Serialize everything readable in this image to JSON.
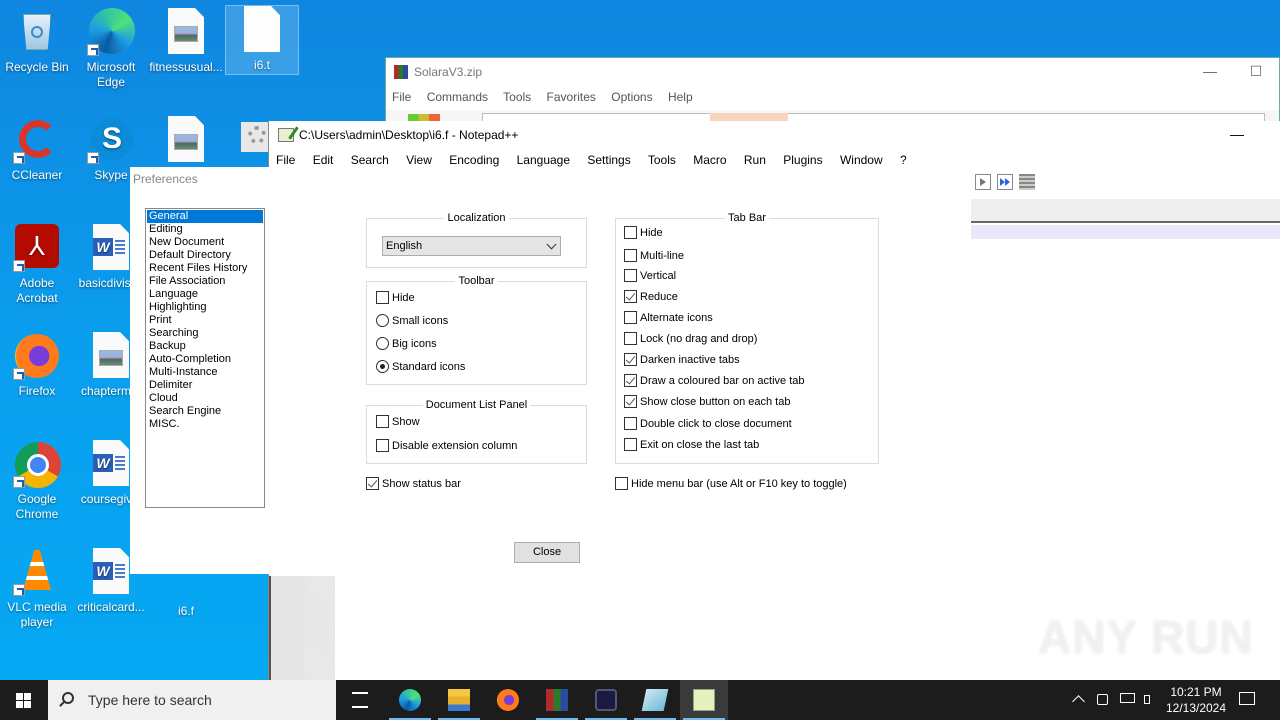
{
  "desktop": {
    "icons": [
      {
        "label": "Recycle Bin"
      },
      {
        "label": "Microsoft Edge"
      },
      {
        "label": "fitnessusual..."
      },
      {
        "label": "i6.t"
      },
      {
        "label": "CCleaner"
      },
      {
        "label": "Skype"
      },
      {
        "label": "Adobe Acrobat"
      },
      {
        "label": "basicdivisi..."
      },
      {
        "label": "Firefox"
      },
      {
        "label": "chapterm..."
      },
      {
        "label": "Google Chrome"
      },
      {
        "label": "coursegiv..."
      },
      {
        "label": "VLC media player"
      },
      {
        "label": "criticalcard..."
      },
      {
        "label": "i6.f"
      }
    ]
  },
  "winrar": {
    "title": "SolaraV3.zip",
    "menu": [
      "File",
      "Commands",
      "Tools",
      "Favorites",
      "Options",
      "Help"
    ],
    "minimize": "—",
    "maximize": "☐"
  },
  "notepadpp": {
    "title": "C:\\Users\\admin\\Desktop\\i6.f - Notepad++",
    "menu": [
      "File",
      "Edit",
      "Search",
      "View",
      "Encoding",
      "Language",
      "Settings",
      "Tools",
      "Macro",
      "Run",
      "Plugins",
      "Window",
      "?"
    ],
    "minimize": "—"
  },
  "preferences": {
    "title": "Preferences",
    "categories": [
      "General",
      "Editing",
      "New Document",
      "Default Directory",
      "Recent Files History",
      "File Association",
      "Language",
      "Highlighting",
      "Print",
      "Searching",
      "Backup",
      "Auto-Completion",
      "Multi-Instance",
      "Delimiter",
      "Cloud",
      "Search Engine",
      "MISC."
    ],
    "selected_category": "General",
    "localization": {
      "label": "Localization",
      "value": "English"
    },
    "toolbar": {
      "label": "Toolbar",
      "hide": {
        "label": "Hide",
        "checked": false
      },
      "options": [
        {
          "label": "Small icons",
          "selected": false
        },
        {
          "label": "Big icons",
          "selected": false
        },
        {
          "label": "Standard icons",
          "selected": true
        }
      ]
    },
    "doclist": {
      "label": "Document List Panel",
      "items": [
        {
          "label": "Show",
          "checked": false
        },
        {
          "label": "Disable extension column",
          "checked": false
        }
      ]
    },
    "show_status_bar": {
      "label": "Show status bar",
      "checked": true
    },
    "tabbar": {
      "label": "Tab Bar",
      "items": [
        {
          "label": "Hide",
          "checked": false
        },
        {
          "label": "Multi-line",
          "checked": false
        },
        {
          "label": "Vertical",
          "checked": false
        },
        {
          "label": "Reduce",
          "checked": true
        },
        {
          "label": "Alternate icons",
          "checked": false
        },
        {
          "label": "Lock (no drag and drop)",
          "checked": false
        },
        {
          "label": "Darken inactive tabs",
          "checked": true
        },
        {
          "label": "Draw a coloured bar on active tab",
          "checked": true
        },
        {
          "label": "Show close button on each tab",
          "checked": true
        },
        {
          "label": "Double click to close document",
          "checked": false
        },
        {
          "label": "Exit on close the last tab",
          "checked": false
        }
      ]
    },
    "hide_menu_bar": {
      "label": "Hide menu bar (use Alt or F10 key to toggle)",
      "checked": false
    },
    "close_label": "Close"
  },
  "taskbar": {
    "search_placeholder": "Type here to search",
    "apps": [
      "task-view",
      "edge",
      "file-explorer",
      "firefox",
      "winrar",
      "unknown-app",
      "notepad",
      "notepad-plus-plus"
    ],
    "time": "10:21 PM",
    "date": "12/13/2024"
  },
  "watermark": "ANY RUN"
}
